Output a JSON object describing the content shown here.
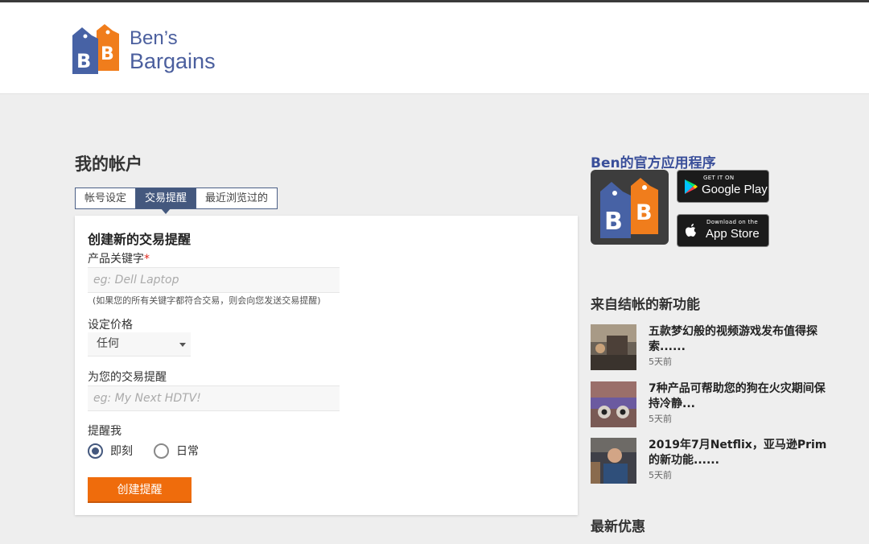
{
  "header": {
    "logo_line1": "Ben’s",
    "logo_line2": "Bargains",
    "logo_letters": "BB"
  },
  "account": {
    "title": "我的帐户",
    "tabs": [
      {
        "label": "帐号设定",
        "active": false
      },
      {
        "label": "交易提醒",
        "active": true
      },
      {
        "label": "最近浏览过的",
        "active": false
      }
    ]
  },
  "form": {
    "title": "创建新的交易提醒",
    "keyword_label": "产品关键字",
    "keyword_required": "*",
    "keyword_placeholder": "eg: Dell Laptop",
    "keyword_hint": "(如果您的所有关键字都符合交易，则会向您发送交易提醒)",
    "price_label": "设定价格",
    "price_value": "任何",
    "name_label": "为您的交易提醒",
    "name_placeholder": "eg: My Next HDTV!",
    "remind_label": "提醒我",
    "remind_options": [
      {
        "label": "即刻",
        "checked": true
      },
      {
        "label": "日常",
        "checked": false
      }
    ],
    "submit_label": "创建提醒"
  },
  "sidebar": {
    "apps_title": "Ben的官方应用程序",
    "google_play": {
      "small": "GET IT ON",
      "big": "Google Play"
    },
    "app_store": {
      "small": "Download on the",
      "big": "App Store"
    },
    "news_title": "来自结帐的新功能",
    "news": [
      {
        "title": "五款梦幻般的视频游戏发布值得探索......",
        "time": "5天前"
      },
      {
        "title": "7种产品可帮助您的狗在火灾期间保持冷静...",
        "time": "5天前"
      },
      {
        "title": "2019年7月Netflix，亚马逊Prim的新功能......",
        "time": "5天前"
      }
    ],
    "deals_title": "最新优惠"
  },
  "colors": {
    "brand_blue": "#44587e",
    "brand_orange": "#ef6c0c",
    "logo_blue": "#4b5f9e"
  }
}
